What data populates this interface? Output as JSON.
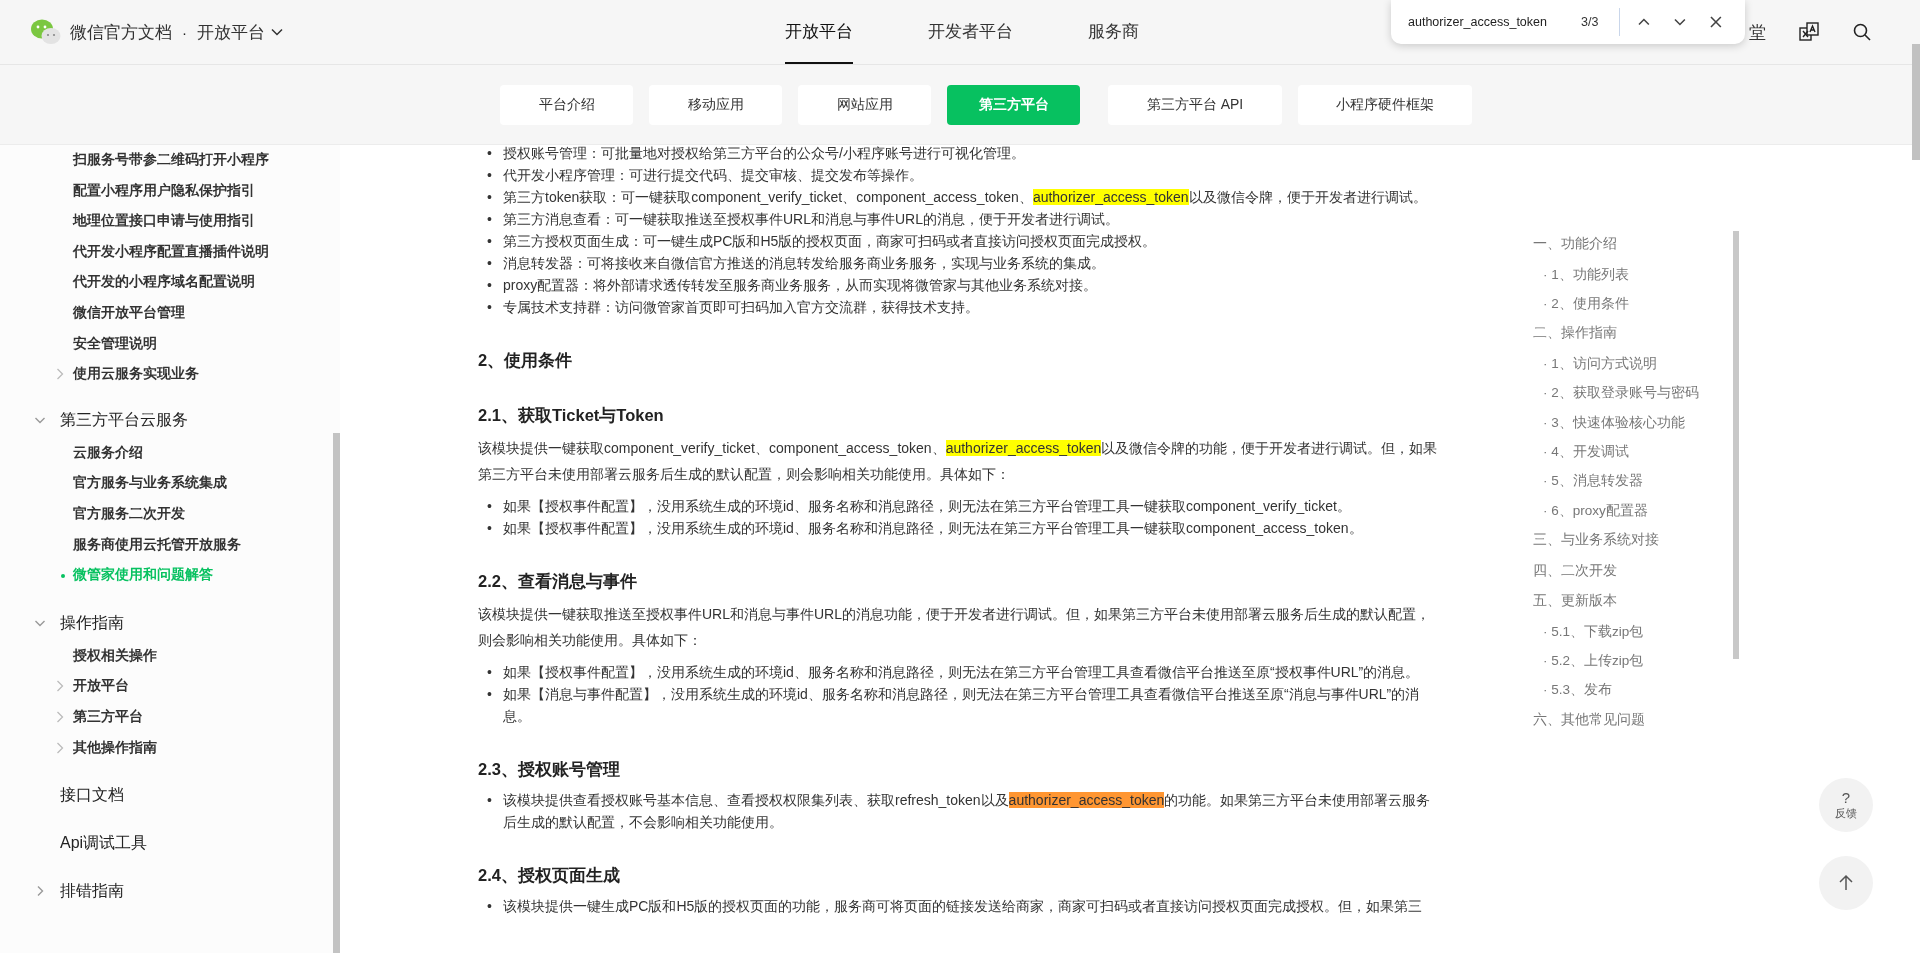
{
  "header": {
    "site_title": "微信官方文档",
    "separator": "·",
    "section_switch": {
      "label": "开放平台",
      "expanded": false
    },
    "nav_tabs": [
      {
        "label": "开放平台",
        "selected": true
      },
      {
        "label": "开发者平台",
        "selected": false
      },
      {
        "label": "服务商",
        "selected": false
      }
    ],
    "right_link": "堂"
  },
  "find_bar": {
    "query": "authorizer_access_token",
    "count": "3/3"
  },
  "sub_nav": [
    {
      "label": "平台介绍",
      "selected": false
    },
    {
      "label": "移动应用",
      "selected": false
    },
    {
      "label": "网站应用",
      "selected": false
    },
    {
      "label": "第三方平台",
      "selected": true
    },
    {
      "label": "第三方平台 API",
      "selected": false
    },
    {
      "label": "小程序硬件框架",
      "selected": false
    }
  ],
  "sidebar": {
    "items": [
      {
        "kind": "page",
        "label": "扫服务号带参二维码打开小程序",
        "selected": false
      },
      {
        "kind": "page",
        "label": "配置小程序用户隐私保护指引",
        "selected": false
      },
      {
        "kind": "page",
        "label": "地理位置接口申请与使用指引",
        "selected": false
      },
      {
        "kind": "page",
        "label": "代开发小程序配置直播插件说明",
        "selected": false
      },
      {
        "kind": "page",
        "label": "代开发的小程序域名配置说明",
        "selected": false
      },
      {
        "kind": "page",
        "label": "微信开放平台管理",
        "selected": false
      },
      {
        "kind": "page",
        "label": "安全管理说明",
        "selected": false
      },
      {
        "kind": "page",
        "label": "使用云服务实现业务",
        "selected": false,
        "expanded": false
      },
      {
        "kind": "section",
        "label": "第三方平台云服务",
        "expanded": true,
        "children": [
          {
            "kind": "page",
            "label": "云服务介绍",
            "selected": false
          },
          {
            "kind": "page",
            "label": "官方服务与业务系统集成",
            "selected": false
          },
          {
            "kind": "page",
            "label": "官方服务二次开发",
            "selected": false
          },
          {
            "kind": "page",
            "label": "服务商使用云托管开放服务",
            "selected": false
          },
          {
            "kind": "page",
            "label": "微管家使用和问题解答",
            "selected": true
          }
        ]
      },
      {
        "kind": "section",
        "label": "操作指南",
        "expanded": true,
        "children": [
          {
            "kind": "page",
            "label": "授权相关操作",
            "selected": false
          },
          {
            "kind": "page",
            "label": "开放平台",
            "selected": false,
            "expanded": false
          },
          {
            "kind": "page",
            "label": "第三方平台",
            "selected": false,
            "expanded": false
          },
          {
            "kind": "page",
            "label": "其他操作指南",
            "selected": false,
            "expanded": false
          }
        ]
      },
      {
        "kind": "section",
        "label": "接口文档"
      },
      {
        "kind": "section",
        "label": "Api调试工具"
      },
      {
        "kind": "section",
        "label": "排错指南",
        "expanded": false
      }
    ]
  },
  "content": {
    "blocks": [
      {
        "kind": "list",
        "marker": "•",
        "items": [
          [
            {
              "text": "授权账号管理：可批量地对授权给第三方平台的公众号/小程序账号进行可视化管理。"
            }
          ],
          [
            {
              "text": "代开发小程序管理：可进行提交代码、提交审核、提交发布等操作。"
            }
          ],
          [
            {
              "text": "第三方token获取：可一键获取component_verify_ticket、component_access_token、"
            },
            {
              "text": "authorizer_access_token",
              "highlighted": true,
              "current": false
            },
            {
              "text": "以及微信令牌，便于开发者进行调试。"
            }
          ],
          [
            {
              "text": "第三方消息查看：可一键获取推送至授权事件URL和消息与事件URL的消息，便于开发者进行调试。"
            }
          ],
          [
            {
              "text": "第三方授权页面生成：可一键生成PC版和H5版的授权页面，商家可扫码或者直接访问授权页面完成授权。"
            }
          ],
          [
            {
              "text": "消息转发器：可将接收来自微信官方推送的消息转发给服务商业务服务，实现与业务系统的集成。"
            }
          ],
          [
            {
              "text": "proxy配置器：将外部请求透传转发至服务商业务服务，从而实现将微管家与其他业务系统对接。"
            }
          ],
          [
            {
              "text": "专属技术支持群：访问微管家首页即可扫码加入官方交流群，获得技术支持。"
            }
          ]
        ]
      },
      {
        "kind": "heading",
        "text": "2、使用条件"
      },
      {
        "kind": "heading",
        "text": "2.1、获取Ticket与Token"
      },
      {
        "kind": "paragraph",
        "parts": [
          {
            "text": "该模块提供一键获取component_verify_ticket、component_access_token、"
          },
          {
            "text": "authorizer_access_token",
            "highlighted": true,
            "current": false
          },
          {
            "text": "以及微信令牌的功能，便于开发者进行调试。但，如果第三方平台未使用部署云服务后生成的默认配置，则会影响相关功能使用。具体如下："
          }
        ]
      },
      {
        "kind": "list",
        "marker": "•",
        "items": [
          [
            {
              "text": "如果【授权事件配置】，没用系统生成的环境id、服务名称和消息路径，则无法在第三方平台管理工具一键获取component_verify_ticket。"
            }
          ],
          [
            {
              "text": "如果【授权事件配置】，没用系统生成的环境id、服务名称和消息路径，则无法在第三方平台管理工具一键获取component_access_token。"
            }
          ]
        ]
      },
      {
        "kind": "heading",
        "text": "2.2、查看消息与事件"
      },
      {
        "kind": "paragraph",
        "parts": [
          {
            "text": "该模块提供一键获取推送至授权事件URL和消息与事件URL的消息功能，便于开发者进行调试。但，如果第三方平台未使用部署云服务后生成的默认配置，则会影响相关功能使用。具体如下："
          }
        ]
      },
      {
        "kind": "list",
        "marker": "•",
        "items": [
          [
            {
              "text": "如果【授权事件配置】，没用系统生成的环境id、服务名称和消息路径，则无法在第三方平台管理工具查看微信平台推送至原“授权事件URL”的消息。"
            }
          ],
          [
            {
              "text": "如果【消息与事件配置】，没用系统生成的环境id、服务名称和消息路径，则无法在第三方平台管理工具查看微信平台推送至原“消息与事件URL”的消息。"
            }
          ]
        ]
      },
      {
        "kind": "heading",
        "text": "2.3、授权账号管理"
      },
      {
        "kind": "list",
        "marker": "•",
        "items": [
          [
            {
              "text": "该模块提供查看授权账号基本信息、查看授权权限集列表、获取refresh_token以及"
            },
            {
              "text": "authorizer_access_token",
              "highlighted": true,
              "current": true
            },
            {
              "text": "的功能。如果第三方平台未使用部署云服务后生成的默认配置，不会影响相关功能使用。"
            }
          ]
        ]
      },
      {
        "kind": "heading",
        "text": "2.4、授权页面生成"
      },
      {
        "kind": "list",
        "marker": "•",
        "items": [
          [
            {
              "text": "该模块提供一键生成PC版和H5版的授权页面的功能，服务商可将页面的链接发送给商家，商家可扫码或者直接访问授权页面完成授权。但，如果第三"
            }
          ]
        ]
      }
    ]
  },
  "toc": [
    {
      "label": "一、功能介绍",
      "children": [
        {
          "label": "· 1、功能列表"
        },
        {
          "label": "· 2、使用条件"
        }
      ]
    },
    {
      "label": "二、操作指南",
      "children": [
        {
          "label": "· 1、访问方式说明"
        },
        {
          "label": "· 2、获取登录账号与密码"
        },
        {
          "label": "· 3、快速体验核心功能"
        },
        {
          "label": "· 4、开发调试"
        },
        {
          "label": "· 5、消息转发器"
        },
        {
          "label": "· 6、proxy配置器"
        }
      ]
    },
    {
      "label": "三、与业务系统对接"
    },
    {
      "label": "四、二次开发"
    },
    {
      "label": "五、更新版本",
      "children": [
        {
          "label": "· 5.1、下载zip包"
        },
        {
          "label": "· 5.2、上传zip包"
        },
        {
          "label": "· 5.3、发布"
        }
      ]
    },
    {
      "label": "六、其他常见问题"
    }
  ],
  "float_buttons": {
    "feedback_icon": "?",
    "feedback_label": "反馈"
  }
}
